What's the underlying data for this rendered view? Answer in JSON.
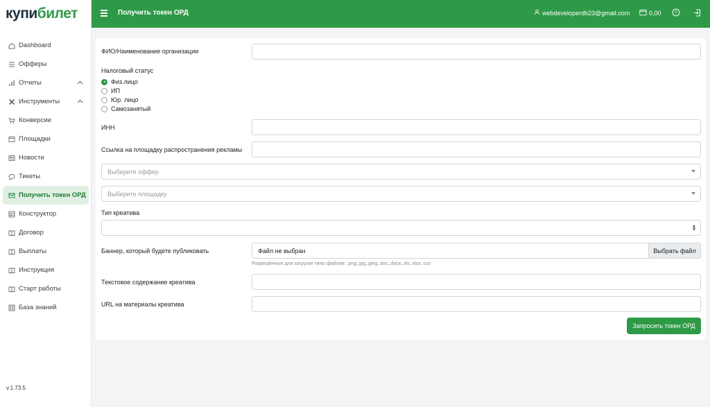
{
  "logo": {
    "part1": "купи",
    "part2": "билет"
  },
  "sidebar": {
    "items": [
      {
        "label": "Dashboard",
        "icon": "home-icon"
      },
      {
        "label": "Офферы",
        "icon": "list-icon"
      },
      {
        "label": "Отчеты",
        "icon": "bar-chart-icon",
        "expand": "chevron-up"
      },
      {
        "label": "Инструменты",
        "icon": "tools-icon",
        "expand": "chevron-up"
      },
      {
        "label": "Конверсии",
        "icon": "cart-icon"
      },
      {
        "label": "Площадки",
        "icon": "window-icon"
      },
      {
        "label": "Новости",
        "icon": "newspaper-icon"
      },
      {
        "label": "Тикеты",
        "icon": "chat-icon"
      },
      {
        "label": "Получить токен ОРД",
        "icon": "mail-icon",
        "active": true
      },
      {
        "label": "Конструктор",
        "icon": "layout-icon"
      },
      {
        "label": "Договор",
        "icon": "book-icon"
      },
      {
        "label": "Выплаты",
        "icon": "book-icon"
      },
      {
        "label": "Инструкция",
        "icon": "book-icon"
      },
      {
        "label": "Старт работы",
        "icon": "book-icon"
      },
      {
        "label": "База знаний",
        "icon": "database-icon"
      }
    ],
    "version": "v.1.73.5"
  },
  "header": {
    "title": "Получить токен ОРД",
    "email": "webdeveloperdb23@gmail.com",
    "balance": "0,00"
  },
  "form": {
    "name_label": "ФИО/Наименование организации",
    "name_value": "",
    "tax_status_label": "Налоговый статус",
    "tax_options": [
      "Физ.лицо",
      "ИП",
      "Юр. лицо",
      "Самозанятый"
    ],
    "tax_selected": "Физ.лицо",
    "inn_label": "ИНН",
    "inn_value": "",
    "link_label": "Ссылка на площадку распространения рекламы",
    "link_value": "",
    "offer_placeholder": "Выберите оффер",
    "platform_placeholder": "Выберите площадку",
    "creative_type_label": "Тип креатива",
    "creative_type_value": "",
    "banner_label": "Баннер, который будете публиковать",
    "file_status": "Файл не выбран",
    "file_button": "Выбрать файл",
    "file_hint": "Разрешённые для загрузки типы файлов: .png,.jpg,.jpeg,.doc,.docx,.xls,.xlsx,.csv",
    "text_label": "Текстовое содержание креатива",
    "text_value": "",
    "url_label": "URL на материалы креатива",
    "url_value": "",
    "submit_label": "Запросить токен ОРД"
  },
  "colors": {
    "brand": "#2e9a47",
    "active_bg": "#dff0e2"
  }
}
